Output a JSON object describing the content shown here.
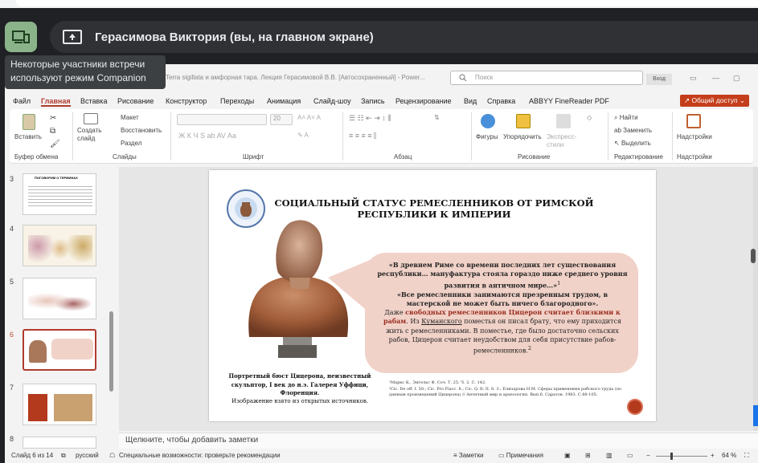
{
  "meet": {
    "presenter_text": "Герасимова Виктория (вы, на главном экране)",
    "tooltip": "Некоторые участники встречи используют режим Companion",
    "companion_icon": "companion-mode-icon",
    "present_icon": "present-screen-icon"
  },
  "ppt": {
    "title": "Terra sigillata и амфорная тара. Лекция Герасимовой В.В. [Автосохраненный] - Power...",
    "search_placeholder": "Поиск",
    "login": "Вход",
    "menu": [
      "Файл",
      "Главная",
      "Вставка",
      "Рисование",
      "Конструктор",
      "Переходы",
      "Анимация",
      "Слайд-шоу",
      "Запись",
      "Рецензирование",
      "Вид",
      "Справка",
      "ABBYY FineReader PDF"
    ],
    "active_menu": "Главная",
    "share": "Общий доступ",
    "ribbon": {
      "paste": "Вставить",
      "create_slide": "Создать слайд",
      "layout": "Макет",
      "restore": "Восстановить",
      "section": "Раздел",
      "font_size": "20",
      "shapes": "Фигуры",
      "arrange": "Упорядочить",
      "express_styles": "Экспресс-стили",
      "find": "Найти",
      "replace": "Заменить",
      "select": "Выделить",
      "addins": "Надстройки",
      "groups": [
        "Буфер обмена",
        "Слайды",
        "Шрифт",
        "Абзац",
        "Рисование",
        "Редактирование",
        "Надстройки"
      ]
    },
    "slide_numbers": [
      "3",
      "4",
      "5",
      "6",
      "7",
      "8"
    ],
    "thumb_titles": [
      "ПОГОВОРИМ О ТЕРМИНАХ",
      "",
      "",
      "",
      "",
      ""
    ],
    "selected_slide": "6",
    "slide": {
      "title": "СОЦИАЛЬНЫЙ СТАТУС РЕМЕСЛЕННИКОВ ОТ РИМСКОЙ РЕСПУБЛИКИ К ИМПЕРИИ",
      "quote1": "«В древнем Риме со времени последних лет существования республики… мануфактура стояла гораздо ниже среднего уровня развития в античном мире…»",
      "quote1_ref": "1",
      "quote2": "«Все ремесленники занимаются презренным трудом, в мастерской не может быть ничего благородного».",
      "even": "Даже ",
      "highlight": "свободных ремесленников Цицерон считает близкими к рабам",
      "from_estate_1": ". Из ",
      "kumanskoe": "Куманского",
      "from_estate_2": " поместья он писал брату, что ему приходится жить с ремесленниками. В поместье, где было достаточно сельских рабов, Цицерон считает неудобством для себя присутствие рабов-ремесленников.",
      "ref2": "2",
      "caption_bold": "Портретный бюст Цицерона, неизвестный скульптор, I век до н.э. Галерея Уффици, Флоренция.",
      "caption_plain": "Изображение взято из открытых источников.",
      "footnote1": "¹Маркс К., Энгельс Ф. Соч. Т. 25. Ч. 2. С. 142.",
      "footnote2": "²Cic. De off. I. 50.; Cic. Pro Flacc. 8.; Cic. Q. fr. II. 8. 3.; Елизарова Н.М. Сферы применения рабского труда (по данным произведений Цицерона) // Античный мир и археология. Вып.6. Саратов. 1983. С.88-105."
    },
    "notes_placeholder": "Щелкните, чтобы добавить заметки",
    "status": {
      "slide_of": "Слайд 6 из 14",
      "lang": "русский",
      "accessibility": "Специальные возможности: проверьте рекомендации",
      "notes": "Заметки",
      "comments": "Примечания",
      "zoom": "64 %"
    }
  },
  "colors": {
    "accent": "#c43e1c",
    "bubble": "#f1d2c8",
    "highlight_text": "#9b2d20",
    "meet_bg": "#202124"
  }
}
